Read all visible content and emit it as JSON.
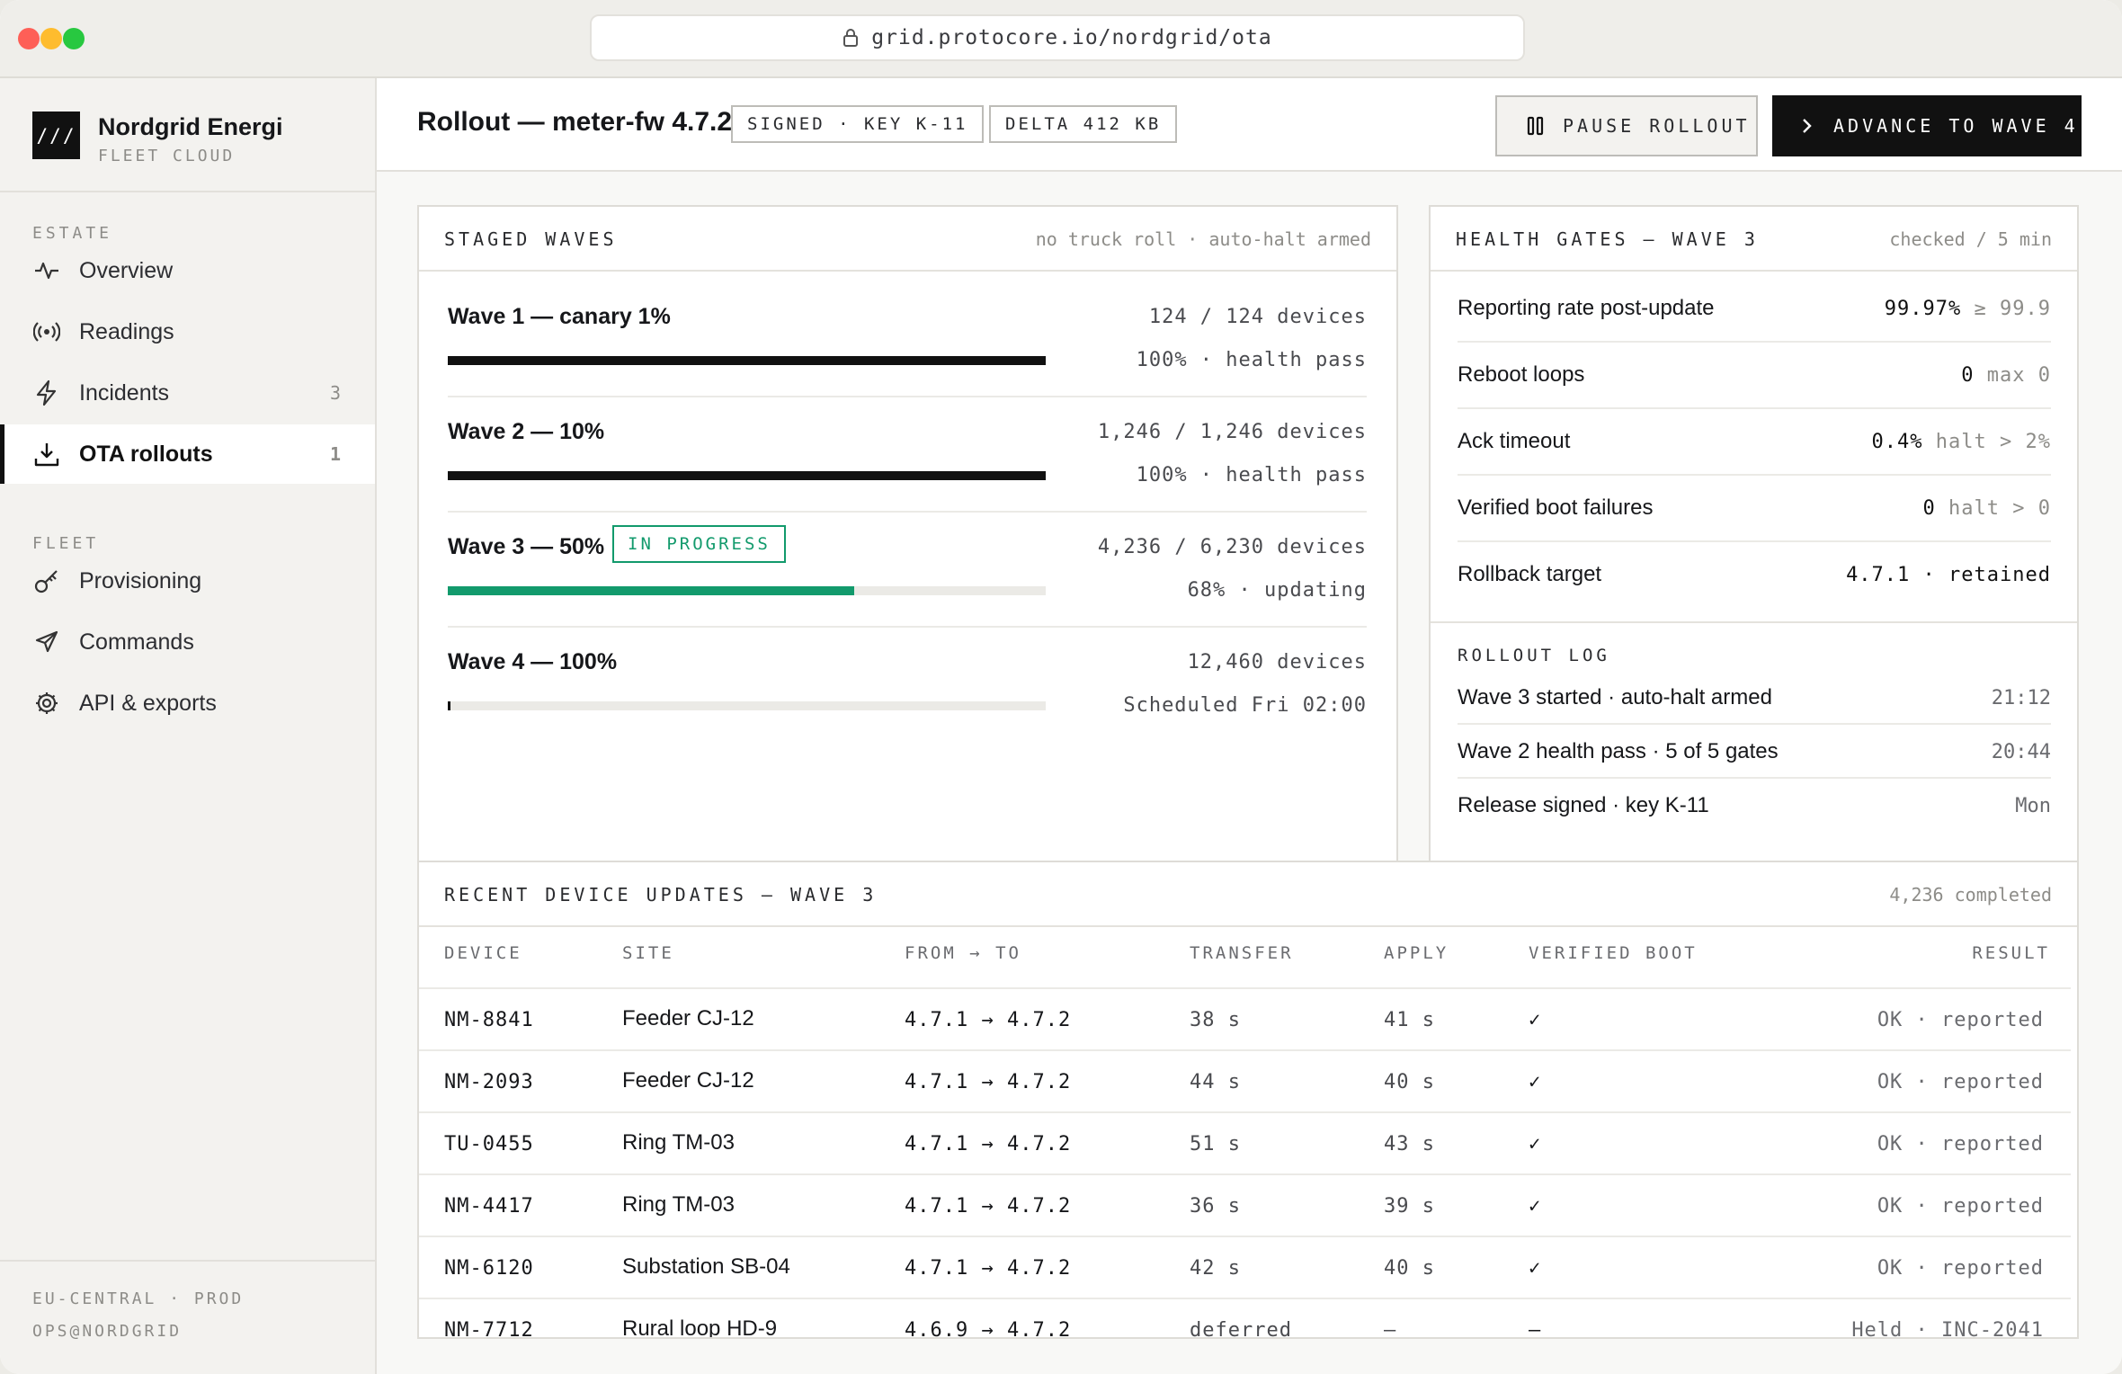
{
  "url": "grid.protocore.io/nordgrid/ota",
  "brand": {
    "name": "Nordgrid Energi",
    "sub": "FLEET CLOUD",
    "logo": "///"
  },
  "sidebar": {
    "sections": [
      {
        "title": "ESTATE",
        "items": [
          {
            "label": "Overview",
            "icon": "pulse-icon",
            "count": ""
          },
          {
            "label": "Readings",
            "icon": "radio-icon",
            "count": ""
          },
          {
            "label": "Incidents",
            "icon": "bolt-icon",
            "count": "3"
          },
          {
            "label": "OTA rollouts",
            "icon": "download-icon",
            "count": "1",
            "active": true
          }
        ]
      },
      {
        "title": "FLEET",
        "items": [
          {
            "label": "Provisioning",
            "icon": "key-icon",
            "count": ""
          },
          {
            "label": "Commands",
            "icon": "send-icon",
            "count": ""
          },
          {
            "label": "API & exports",
            "icon": "gear-icon",
            "count": ""
          }
        ]
      }
    ],
    "footer": [
      "EU-CENTRAL · PROD",
      "OPS@NORDGRID"
    ]
  },
  "header": {
    "title": "Rollout — meter-fw 4.7.2",
    "tags": [
      "SIGNED · KEY K-11",
      "DELTA 412 KB"
    ],
    "pause_label": "PAUSE ROLLOUT",
    "advance_label": "ADVANCE TO WAVE 4"
  },
  "waves": {
    "title": "STAGED WAVES",
    "meta": "no truck roll · auto-halt armed",
    "items": [
      {
        "name": "Wave 1 — canary 1%",
        "devices": "124 / 124 devices",
        "status": "100% · health pass",
        "progress": 1.0,
        "color": "#111111",
        "badge": ""
      },
      {
        "name": "Wave 2 — 10%",
        "devices": "1,246 / 1,246 devices",
        "status": "100% · health pass",
        "progress": 1.0,
        "color": "#111111",
        "badge": ""
      },
      {
        "name": "Wave 3 — 50%",
        "devices": "4,236 / 6,230 devices",
        "status": "68% · updating",
        "progress": 0.68,
        "color": "#129a6c",
        "badge": "IN PROGRESS"
      },
      {
        "name": "Wave 4 — 100%",
        "devices": "12,460 devices",
        "status": "Scheduled Fri 02:00",
        "progress": 0.005,
        "color": "#111111",
        "badge": ""
      }
    ]
  },
  "gates": {
    "title": "HEALTH GATES — WAVE 3",
    "meta": "checked / 5 min",
    "items": [
      {
        "label": "Reporting rate post-update",
        "value": "99.97%",
        "limit": "≥ 99.9"
      },
      {
        "label": "Reboot loops",
        "value": "0",
        "limit": "max 0"
      },
      {
        "label": "Ack timeout",
        "value": "0.4%",
        "limit": "halt > 2%"
      },
      {
        "label": "Verified boot failures",
        "value": "0",
        "limit": "halt > 0"
      },
      {
        "label": "Rollback target",
        "value": "4.7.1",
        "limit": "· retained"
      }
    ],
    "log_title": "ROLLOUT LOG",
    "log": [
      {
        "text": "Wave 3 started · auto-halt armed",
        "time": "21:12"
      },
      {
        "text": "Wave 2 health pass · 5 of 5 gates",
        "time": "20:44"
      },
      {
        "text": "Release signed · key K-11",
        "time": "Mon"
      }
    ]
  },
  "updates": {
    "title": "RECENT DEVICE UPDATES — WAVE 3",
    "meta": "4,236 completed",
    "columns": [
      "DEVICE",
      "SITE",
      "FROM → TO",
      "TRANSFER",
      "APPLY",
      "VERIFIED BOOT",
      "RESULT"
    ],
    "rows": [
      {
        "device": "NM-8841",
        "site": "Feeder CJ-12",
        "fromto": "4.7.1 → 4.7.2",
        "transfer": "38 s",
        "apply": "41 s",
        "boot": "✓",
        "result": "OK · reported"
      },
      {
        "device": "NM-2093",
        "site": "Feeder CJ-12",
        "fromto": "4.7.1 → 4.7.2",
        "transfer": "44 s",
        "apply": "40 s",
        "boot": "✓",
        "result": "OK · reported"
      },
      {
        "device": "TU-0455",
        "site": "Ring TM-03",
        "fromto": "4.7.1 → 4.7.2",
        "transfer": "51 s",
        "apply": "43 s",
        "boot": "✓",
        "result": "OK · reported"
      },
      {
        "device": "NM-4417",
        "site": "Ring TM-03",
        "fromto": "4.7.1 → 4.7.2",
        "transfer": "36 s",
        "apply": "39 s",
        "boot": "✓",
        "result": "OK · reported"
      },
      {
        "device": "NM-6120",
        "site": "Substation SB-04",
        "fromto": "4.7.1 → 4.7.2",
        "transfer": "42 s",
        "apply": "40 s",
        "boot": "✓",
        "result": "OK · reported"
      },
      {
        "device": "NM-7712",
        "site": "Rural loop HD-9",
        "fromto": "4.6.9 → 4.7.2",
        "transfer": "deferred",
        "apply": "—",
        "boot": "—",
        "result": "Held · INC-2041"
      }
    ]
  }
}
